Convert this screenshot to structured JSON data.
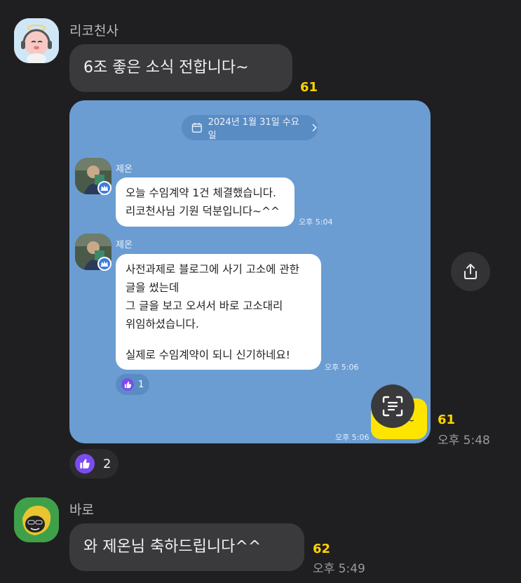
{
  "messages": [
    {
      "sender": "리코천사",
      "text": "6조 좋은 소식 전합니다~",
      "unread": "61"
    },
    {
      "unread": "61",
      "time": "오후 5:48",
      "screenshot": {
        "date": "2024년 1월 31일 수요일",
        "messages": [
          {
            "sender": "제온",
            "lines": [
              "오늘 수임계약 1건 체결했습니다.",
              "리코천사님 기원 덕분입니다~^^"
            ],
            "time": "오후 5:04"
          },
          {
            "sender": "제온",
            "lines": [
              "사전과제로 블로그에 사기 고소에 관한",
              "글을 썼는데",
              "그 글을 보고 오셔서 바로 고소대리",
              "위임하셨습니다.",
              "",
              "실제로 수임계약이 되니 신기하네요!"
            ],
            "time": "오후 5:06",
            "reaction_count": "1"
          }
        ],
        "peek_time": "오후 5:06",
        "peek_text": "~"
      },
      "reaction_count": "2"
    },
    {
      "sender": "바로",
      "text": "와 제온님 축하드립니다^^",
      "unread": "62",
      "time": "오후 5:49"
    }
  ],
  "colors": {
    "background": "#1f1f21",
    "bubble": "#3a3a3d",
    "unread": "#ffd400",
    "screenshot_bg": "#6b9dd3",
    "kakao_yellow": "#fee500",
    "reaction": "#7c4cf0"
  },
  "icons": [
    "calendar-icon",
    "chevron-right-icon",
    "verified-badge-icon",
    "thumbs-up-icon",
    "text-scan-icon",
    "share-icon"
  ]
}
